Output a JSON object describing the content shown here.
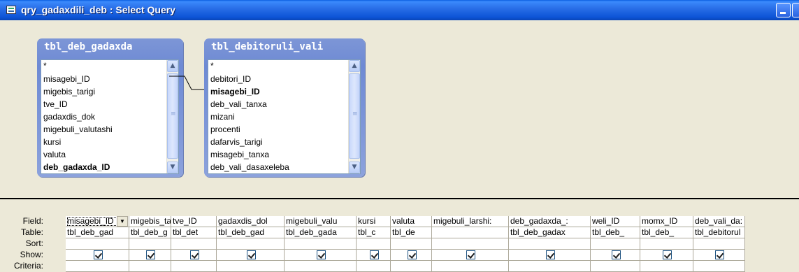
{
  "window": {
    "title": "qry_gadaxdili_deb : Select Query"
  },
  "tables": [
    {
      "title": "tbl_deb_gadaxda",
      "fields": [
        "*",
        "misagebi_ID",
        "migebis_tarigi",
        "tve_ID",
        "gadaxdis_dok",
        "migebuli_valutashi",
        "kursi",
        "valuta",
        "deb_gadaxda_ID"
      ],
      "bold_field_index": 8
    },
    {
      "title": "tbl_debitoruli_vali",
      "fields": [
        "*",
        "debitori_ID",
        "misagebi_ID",
        "deb_vali_tanxa",
        "mizani",
        "procenti",
        "dafarvis_tarigi",
        "misagebi_tanxa",
        "deb_vali_dasaxeleba"
      ],
      "bold_field_index": 2
    }
  ],
  "grid": {
    "row_labels": [
      "Field:",
      "Table:",
      "Sort:",
      "Show:",
      "Criteria:"
    ],
    "columns": [
      {
        "field": "misagebi_ID",
        "table": "tbl_deb_gad",
        "show": true
      },
      {
        "field": "migebis_ta",
        "table": "tbl_deb_g",
        "show": true
      },
      {
        "field": "tve_ID",
        "table": "tbl_det",
        "show": true
      },
      {
        "field": "gadaxdis_dol",
        "table": "tbl_deb_gad",
        "show": true
      },
      {
        "field": "migebuli_valu",
        "table": "tbl_deb_gada",
        "show": true
      },
      {
        "field": "kursi",
        "table": "tbl_c",
        "show": true
      },
      {
        "field": "valuta",
        "table": "tbl_de",
        "show": true
      },
      {
        "field": "migebuli_larshi:",
        "table": "",
        "show": true
      },
      {
        "field": "deb_gadaxda_:",
        "table": "tbl_deb_gadax",
        "show": true
      },
      {
        "field": "weli_ID",
        "table": "tbl_deb_",
        "show": true
      },
      {
        "field": "momx_ID",
        "table": "tbl_deb_",
        "show": true
      },
      {
        "field": "deb_vali_da:",
        "table": "tbl_debitorul",
        "show": true
      }
    ]
  },
  "icons": {
    "title": "query-icon",
    "scroll_up": "▲",
    "scroll_down": "▼",
    "scroll_left": "◀",
    "dropdown": "▼"
  }
}
